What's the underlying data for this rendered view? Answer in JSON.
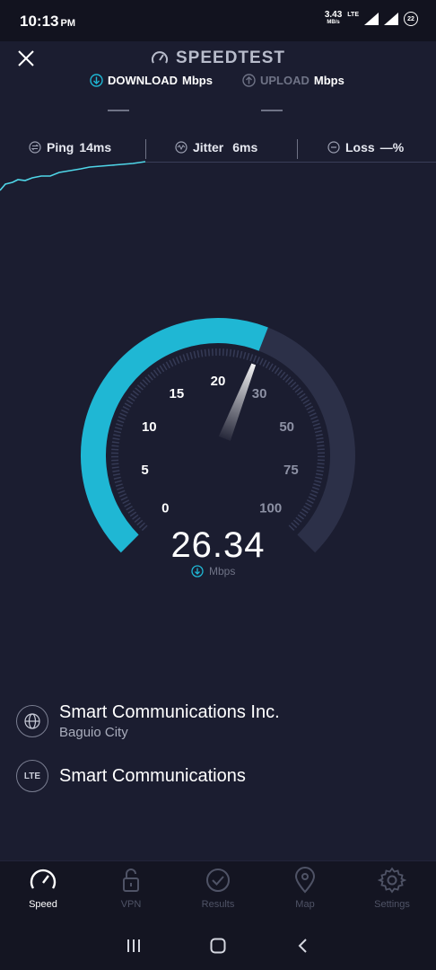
{
  "status": {
    "time": "10:13",
    "ampm": "PM",
    "net_speed": "3.43",
    "net_unit": "MB/s",
    "lte": "LTE",
    "battery": "22"
  },
  "header": {
    "title": "SPEEDTEST",
    "download_label": "DOWNLOAD",
    "download_unit": "Mbps",
    "upload_label": "UPLOAD",
    "upload_unit": "Mbps"
  },
  "metrics": {
    "ping_label": "Ping",
    "ping_value": "14ms",
    "jitter_label": "Jitter",
    "jitter_value": "6ms",
    "loss_label": "Loss",
    "loss_value": "—%"
  },
  "gauge": {
    "value": "26.34",
    "unit": "Mbps",
    "current": 26.34,
    "ticks": [
      "0",
      "5",
      "10",
      "15",
      "20",
      "30",
      "50",
      "75",
      "100"
    ],
    "accent": "#1fb7d4"
  },
  "isp": {
    "provider": "Smart Communications Inc.",
    "location": "Baguio City",
    "lte_badge": "LTE",
    "network": "Smart Communications"
  },
  "nav": {
    "speed": "Speed",
    "vpn": "VPN",
    "results": "Results",
    "map": "Map",
    "settings": "Settings"
  }
}
